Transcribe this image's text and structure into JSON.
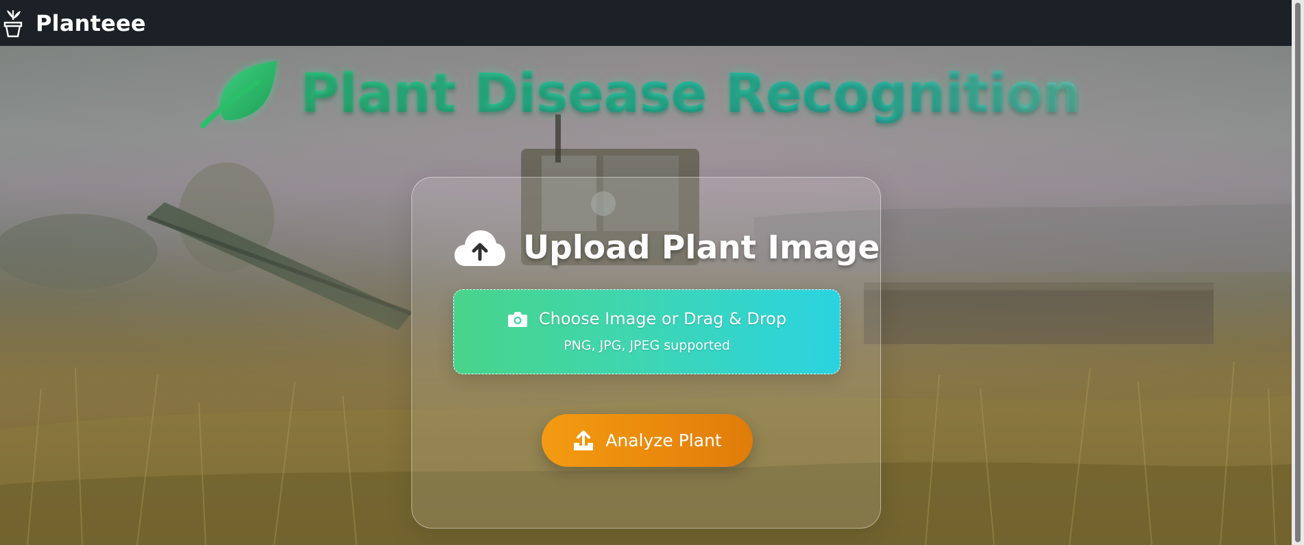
{
  "app": {
    "brand_name": "Planteee",
    "brand_icon": "potted-plant-icon"
  },
  "hero": {
    "title": "Plant Disease Recognition",
    "title_icon": "leaf-icon"
  },
  "upload_card": {
    "heading": "Upload Plant Image",
    "heading_icon": "cloud-upload-icon",
    "dropzone": {
      "label": "Choose Image or Drag & Drop",
      "hint": "PNG, JPG, JPEG supported",
      "icon": "camera-icon"
    },
    "analyze_button": {
      "label": "Analyze Plant",
      "icon": "upload-icon"
    }
  },
  "colors": {
    "navbar_bg": "#1b2126",
    "title_green": "#2bb673",
    "dropzone_start": "#48d48a",
    "dropzone_end": "#2ad3e0",
    "button_orange": "#f39b12"
  }
}
